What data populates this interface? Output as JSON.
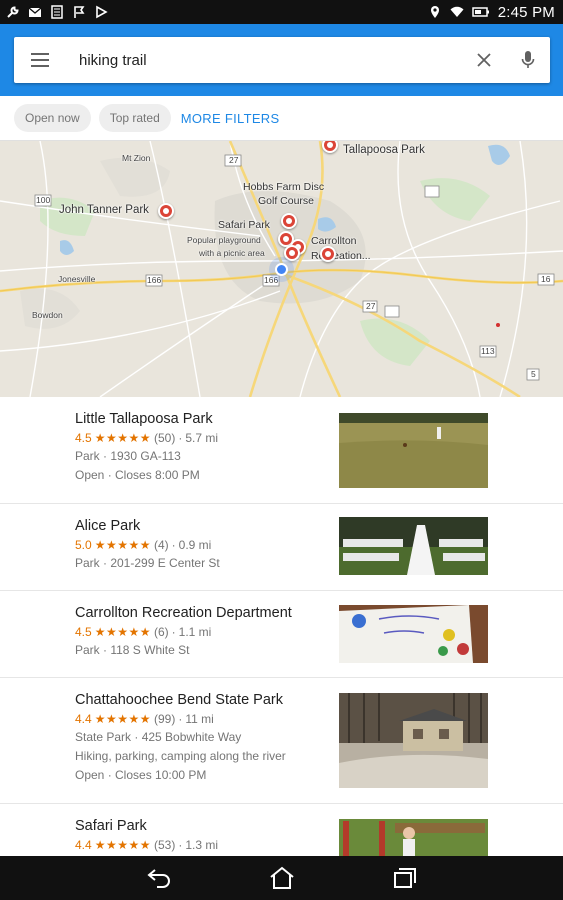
{
  "status_bar": {
    "time": "2:45 PM",
    "left_icons": [
      "wrench-icon",
      "mail-icon",
      "sim-icon",
      "flag-icon",
      "play-icon"
    ],
    "right_icons": [
      "location-icon",
      "wifi-icon",
      "battery-icon"
    ]
  },
  "search": {
    "query": "hiking trail",
    "menu_icon": "hamburger-menu-icon",
    "clear_icon": "close-icon",
    "voice_icon": "microphone-icon"
  },
  "filters": {
    "chips": [
      "Open now",
      "Top rated"
    ],
    "more_label": "MORE FILTERS"
  },
  "map": {
    "labels": {
      "tallapoosa_park": "Tallapoosa Park",
      "mt_zion": "Mt Zion",
      "hobbs_farm_1": "Hobbs Farm Disc",
      "hobbs_farm_2": "Golf Course",
      "john_tanner": "John Tanner Park",
      "safari_park": "Safari Park",
      "popular_1": "Popular playground",
      "popular_2": "with a picnic area",
      "carrollton_1": "Carrollton",
      "carrollton_2": "Recreation...",
      "jonesville": "Jonesville",
      "bowdon": "Bowdon",
      "hwy_27": "27",
      "hwy_166": "166",
      "hwy_100": "100",
      "hwy_16": "16",
      "hwy_5": "5",
      "hwy_113": "113"
    }
  },
  "results": [
    {
      "name": "Little Tallapoosa Park",
      "score": "4.5",
      "stars": "★★★★★",
      "reviews": "(50)",
      "distance": "5.7 mi",
      "lines": [
        "Park · 1930 GA-113",
        "Open · Closes 8:00 PM"
      ]
    },
    {
      "name": "Alice Park",
      "score": "5.0",
      "stars": "★★★★★",
      "reviews": "(4)",
      "distance": "0.9 mi",
      "lines": [
        "Park · 201-299 E Center St"
      ]
    },
    {
      "name": "Carrollton Recreation Department",
      "score": "4.5",
      "stars": "★★★★★",
      "reviews": "(6)",
      "distance": "1.1 mi",
      "lines": [
        "Park · 118 S White St"
      ]
    },
    {
      "name": "Chattahoochee Bend State Park",
      "score": "4.4",
      "stars": "★★★★★",
      "reviews": "(99)",
      "distance": "11 mi",
      "lines": [
        "State Park · 425 Bobwhite Way",
        "Hiking, parking, camping along the river",
        "Open · Closes 10:00 PM"
      ]
    },
    {
      "name": "Safari Park",
      "score": "4.4",
      "stars": "★★★★★",
      "reviews": "(53)",
      "distance": "1.3 mi",
      "lines": []
    }
  ],
  "colors": {
    "accent": "#1e88e5",
    "rating": "#e37400",
    "pin": "#db4437",
    "location": "#4285f4"
  },
  "nav_bar": {
    "icons": [
      "back-icon",
      "home-icon",
      "recents-icon"
    ]
  }
}
